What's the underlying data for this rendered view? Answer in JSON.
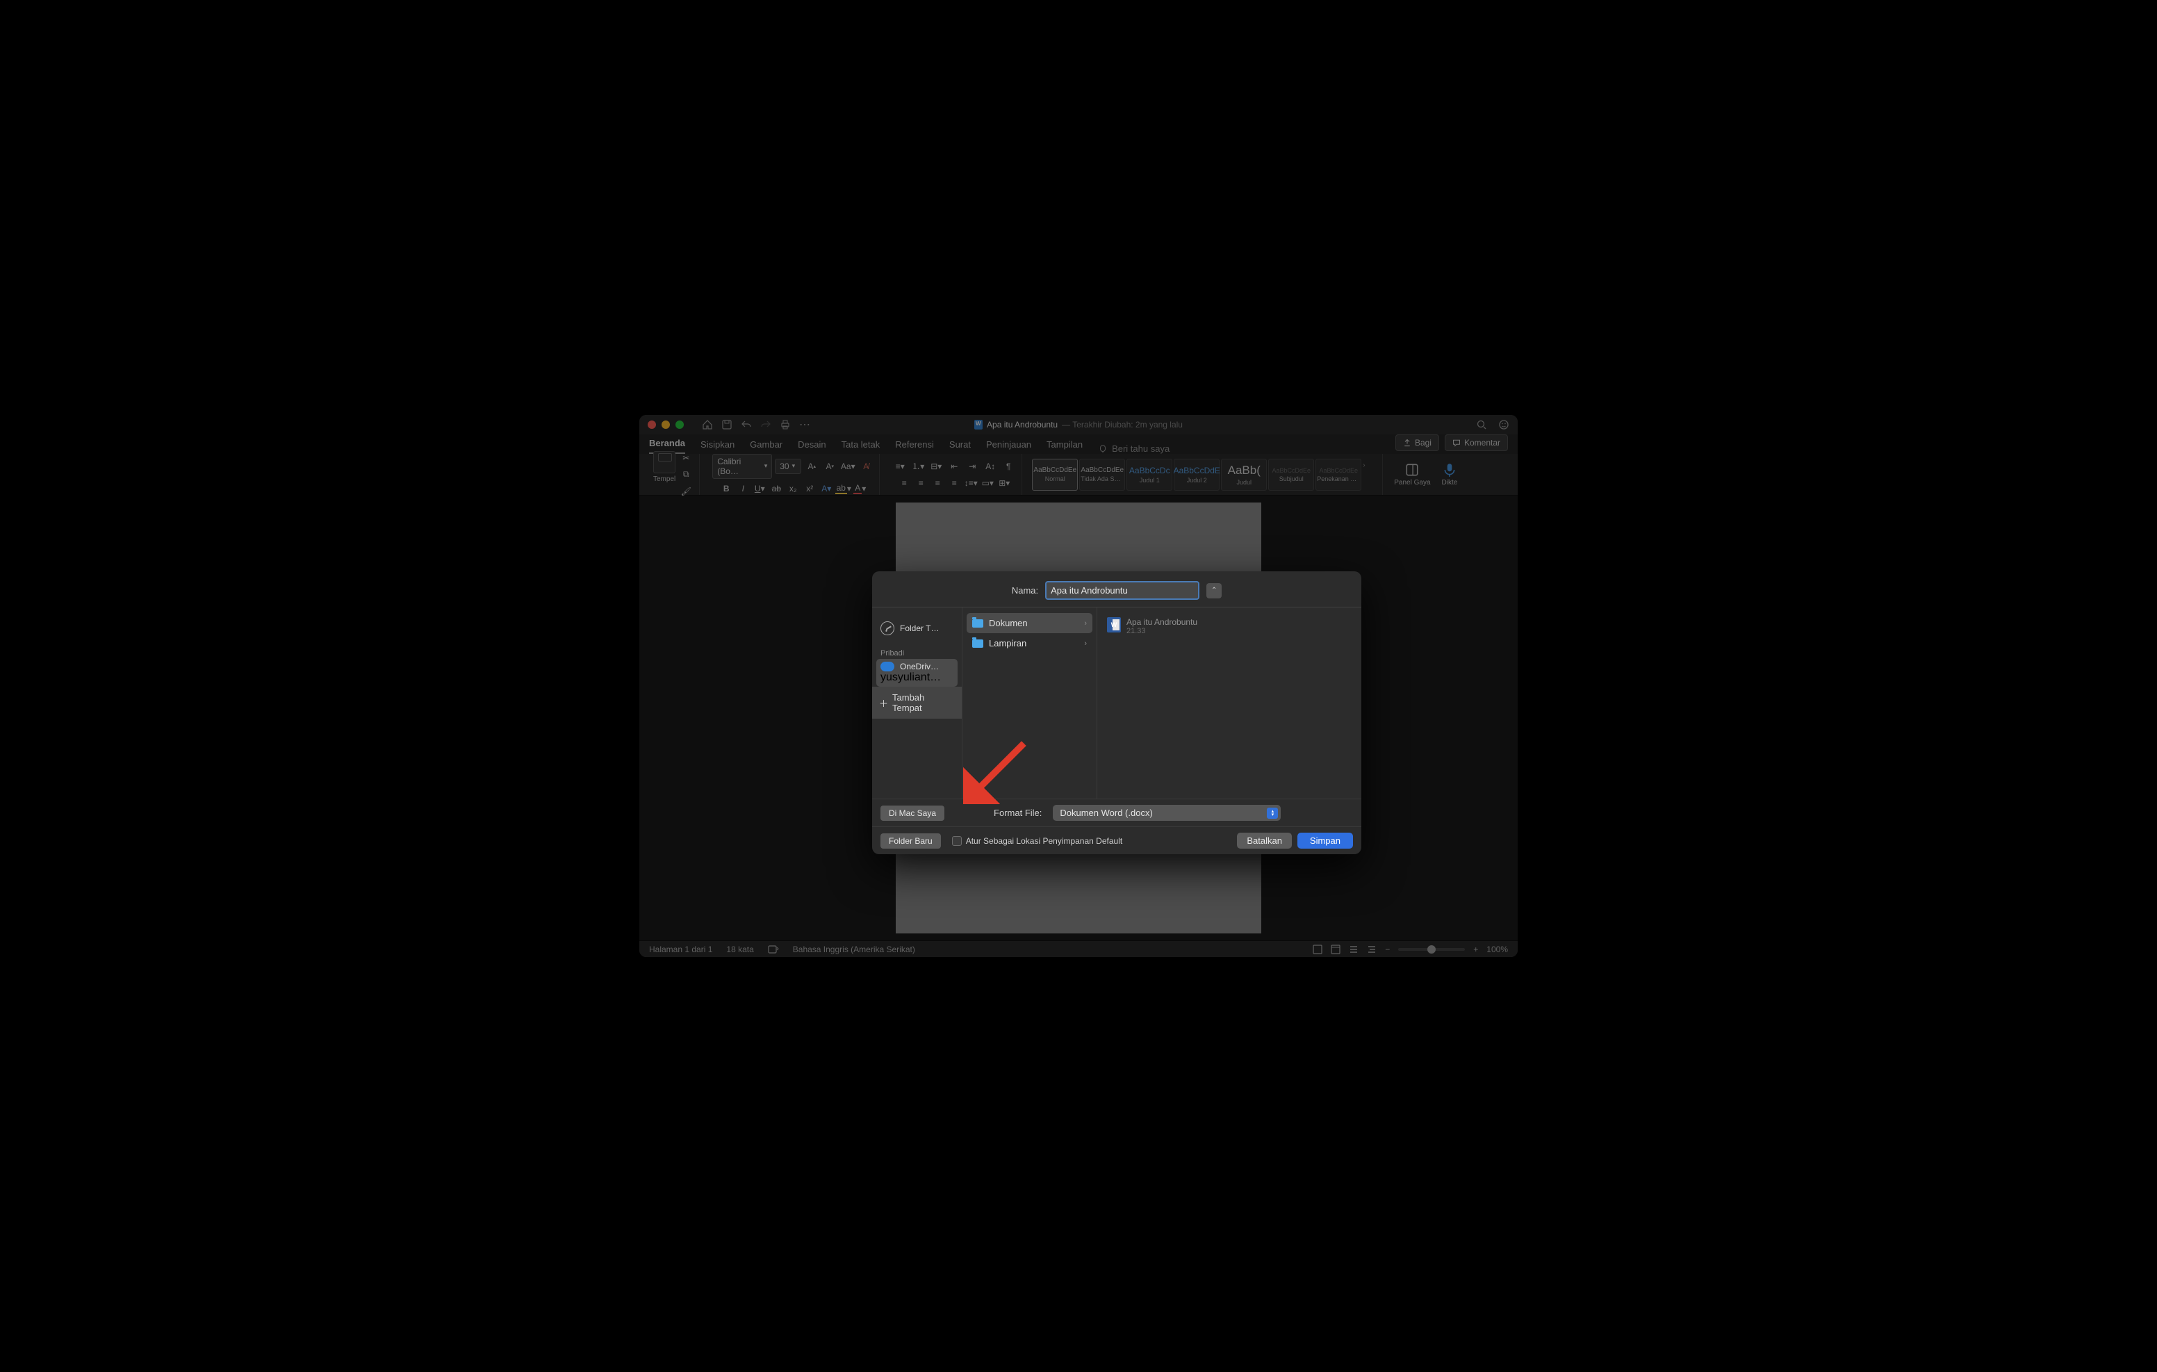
{
  "titlebar": {
    "doc_name": "Apa itu Androbuntu",
    "subtitle": "— Terakhir Diubah: 2m yang lalu"
  },
  "tabs": {
    "items": [
      "Beranda",
      "Sisipkan",
      "Gambar",
      "Desain",
      "Tata letak",
      "Referensi",
      "Surat",
      "Peninjauan",
      "Tampilan"
    ],
    "tell_me": "Beri tahu saya",
    "share": "Bagi",
    "comments": "Komentar"
  },
  "ribbon": {
    "paste_label": "Tempel",
    "font_name": "Calibri (Bo…",
    "font_size": "30",
    "styles": [
      {
        "preview": "AaBbCcDdEe",
        "label": "Normal",
        "cls": "active"
      },
      {
        "preview": "AaBbCcDdEe",
        "label": "Tidak Ada Sp…",
        "cls": ""
      },
      {
        "preview": "AaBbCcDc",
        "label": "Judul 1",
        "cls": "blue"
      },
      {
        "preview": "AaBbCcDdE",
        "label": "Judul 2",
        "cls": "blue"
      },
      {
        "preview": "AaBb(",
        "label": "Judul",
        "cls": "big"
      },
      {
        "preview": "AaBbCcDdEe",
        "label": "Subjudul",
        "cls": "faint"
      },
      {
        "preview": "AaBbCcDdEe",
        "label": "Penekanan H…",
        "cls": "faint"
      }
    ],
    "pane_label": "Panel Gaya",
    "dictate_label": "Dikte"
  },
  "dialog": {
    "name_label": "Nama:",
    "name_value": "Apa itu Androbuntu",
    "places": {
      "recent": "Folder T…",
      "section": "Pribadi",
      "onedrive": "OneDriv…",
      "onedrive_sub": "yusyuliant…",
      "add_place": "Tambah Tempat"
    },
    "folders": [
      {
        "name": "Dokumen",
        "sel": true
      },
      {
        "name": "Lampiran",
        "sel": false
      }
    ],
    "files": [
      {
        "name": "Apa itu Androbuntu",
        "time": "21.33"
      }
    ],
    "on_my_mac": "Di Mac Saya",
    "format_label": "Format File:",
    "format_value": "Dokumen Word (.docx)",
    "folder_new": "Folder Baru",
    "default_loc": "Atur Sebagai Lokasi Penyimpanan Default",
    "cancel": "Batalkan",
    "save": "Simpan"
  },
  "status": {
    "page": "Halaman 1 dari 1",
    "words": "18 kata",
    "lang": "Bahasa Inggris (Amerika Serikat)",
    "zoom": "100%"
  }
}
